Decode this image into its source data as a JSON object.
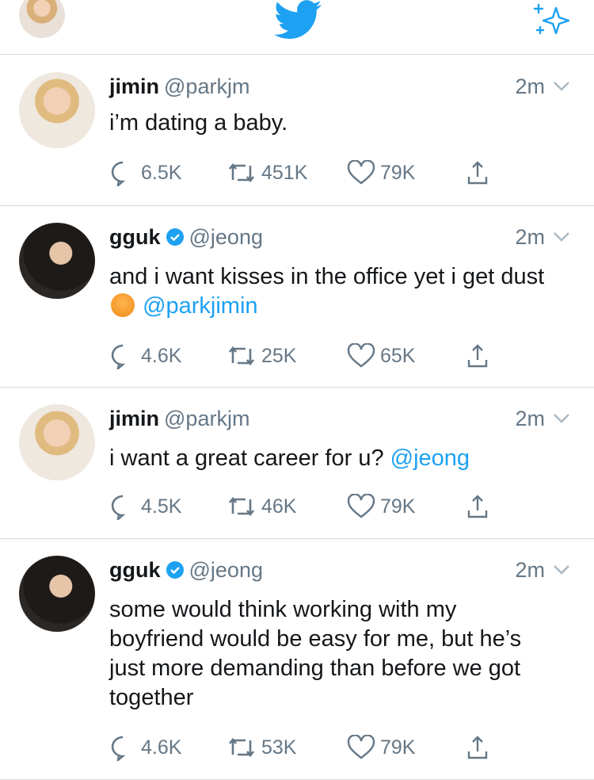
{
  "tweets": [
    {
      "name": "jimin",
      "handle": "@parkjm",
      "verified": false,
      "time": "2m",
      "text": "i’m dating a baby.",
      "mention": "",
      "replies": "6.5K",
      "retweets": "451K",
      "likes": "79K"
    },
    {
      "name": "gguk",
      "handle": "@jeong",
      "verified": true,
      "time": "2m",
      "text": "and i want kisses in the office yet i get dust",
      "mention": "@parkjimin",
      "replies": "4.6K",
      "retweets": "25K",
      "likes": "65K"
    },
    {
      "name": "jimin",
      "handle": "@parkjm",
      "verified": false,
      "time": "2m",
      "text": "i want a great career for u?",
      "mention": "@jeong",
      "replies": "4.5K",
      "retweets": "46K",
      "likes": "79K"
    },
    {
      "name": "gguk",
      "handle": "@jeong",
      "verified": true,
      "time": "2m",
      "text": "some would think working with my boyfriend would be easy for me, but he’s just more demanding than before we got together",
      "mention": "",
      "replies": "4.6K",
      "retweets": "53K",
      "likes": "79K"
    }
  ],
  "colors": {
    "accent": "#1da1f2",
    "muted": "#657786",
    "text": "#14171a"
  },
  "icons": [
    "twitter-bird-icon",
    "sparkle-icon",
    "reply-icon",
    "retweet-icon",
    "heart-icon",
    "share-icon",
    "verified-icon",
    "chevron-down-icon"
  ]
}
